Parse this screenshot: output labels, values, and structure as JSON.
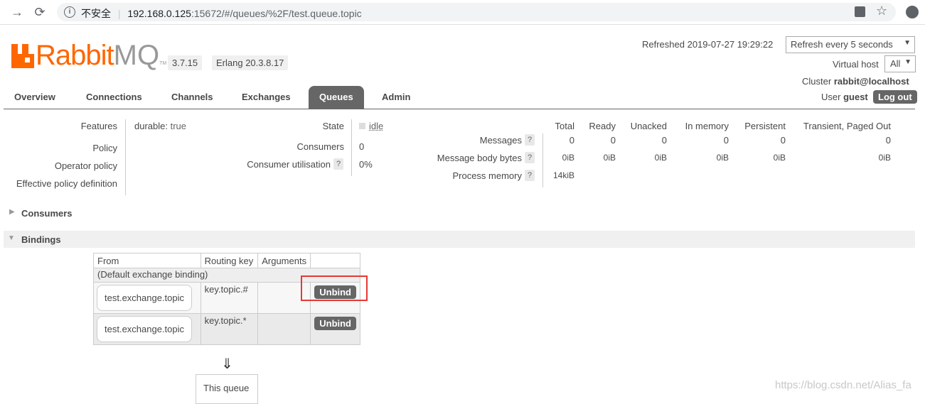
{
  "browser": {
    "security": "不安全",
    "url_host": "192.168.0.125",
    "url_rest": ":15672/#/queues/%2F/test.queue.topic"
  },
  "header": {
    "logo_main": "Rabbit",
    "logo_mq": "MQ",
    "logo_tm": "TM",
    "version": "3.7.15",
    "erlang": "Erlang 20.3.8.17",
    "refreshed": "Refreshed 2019-07-27 19:29:22",
    "refresh_select": "Refresh every 5 seconds",
    "vhost_label": "Virtual host",
    "vhost_value": "All",
    "cluster_label": "Cluster",
    "cluster_value": "rabbit@localhost",
    "user_label": "User",
    "user_value": "guest",
    "logout": "Log out"
  },
  "tabs": [
    "Overview",
    "Connections",
    "Channels",
    "Exchanges",
    "Queues",
    "Admin"
  ],
  "details": {
    "features_label": "Features",
    "features_key": "durable:",
    "features_val": "true",
    "policy_label": "Policy",
    "op_policy_label": "Operator policy",
    "eff_policy_label": "Effective policy definition",
    "state_label": "State",
    "state_value": "idle",
    "consumers_label": "Consumers",
    "consumers_value": "0",
    "util_label": "Consumer utilisation",
    "util_value": "0%"
  },
  "stats": {
    "columns": [
      "Total",
      "Ready",
      "Unacked",
      "In memory",
      "Persistent",
      "Transient, Paged Out"
    ],
    "rows": [
      {
        "label": "Messages",
        "values": [
          "0",
          "0",
          "0",
          "0",
          "0",
          "0"
        ]
      },
      {
        "label": "Message body bytes",
        "values": [
          "0iB",
          "0iB",
          "0iB",
          "0iB",
          "0iB",
          "0iB"
        ]
      },
      {
        "label": "Process memory",
        "values": [
          "14kiB"
        ]
      }
    ],
    "help": "?"
  },
  "sections": {
    "consumers": "Consumers",
    "bindings": "Bindings"
  },
  "bindings": {
    "headers": [
      "From",
      "Routing key",
      "Arguments",
      ""
    ],
    "default_row": "(Default exchange binding)",
    "rows": [
      {
        "from": "test.exchange.topic",
        "key": "key.topic.#",
        "action": "Unbind"
      },
      {
        "from": "test.exchange.topic",
        "key": "key.topic.*",
        "action": "Unbind"
      }
    ],
    "arrow": "⇓",
    "this_queue": "This queue"
  },
  "watermark": "https://blog.csdn.net/Alias_fa"
}
